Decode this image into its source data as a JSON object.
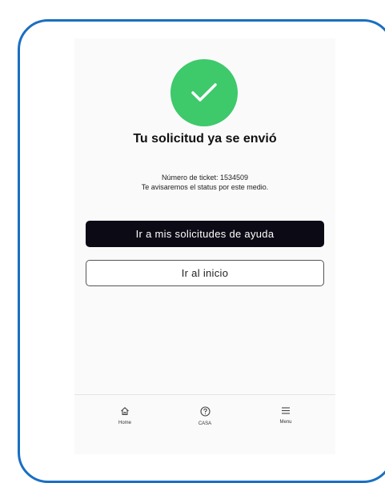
{
  "theme": {
    "accent": "#3ec96a",
    "frame": "#1a6fc2",
    "primary_button_bg": "#0c0b15"
  },
  "success": {
    "icon": "check-icon",
    "title": "Tu solicitud ya se envió",
    "ticket_line": "Número de ticket: 1534509",
    "notice_line": "Te avisaremos el status por este medio."
  },
  "actions": {
    "primary_label": "Ir a mis solicitudes de ayuda",
    "secondary_label": "Ir al inicio"
  },
  "bottom_nav": {
    "items": [
      {
        "label": "Home",
        "icon": "home-icon"
      },
      {
        "label": "CASA",
        "icon": "help-icon"
      },
      {
        "label": "Menu",
        "icon": "menu-icon"
      }
    ]
  }
}
